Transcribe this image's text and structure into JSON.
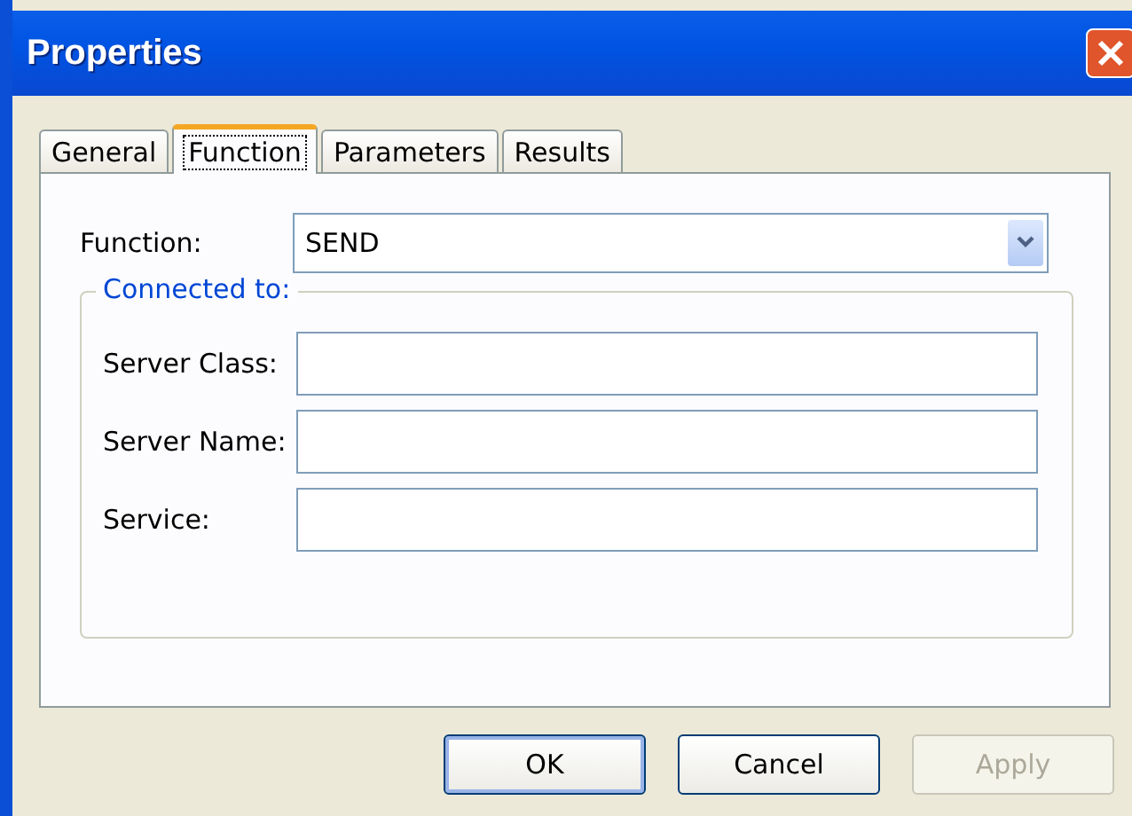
{
  "window": {
    "title": "Properties"
  },
  "tabs": [
    {
      "label": "General",
      "selected": false
    },
    {
      "label": "Function",
      "selected": true
    },
    {
      "label": "Parameters",
      "selected": false
    },
    {
      "label": "Results",
      "selected": false
    }
  ],
  "function_field": {
    "label": "Function:",
    "value": "SEND"
  },
  "group": {
    "title": "Connected to:",
    "fields": [
      {
        "label": "Server Class:"
      },
      {
        "label": "Server Name:"
      },
      {
        "label": "Service:"
      }
    ]
  },
  "buttons": [
    {
      "label": "OK",
      "default": true,
      "disabled": false
    },
    {
      "label": "Cancel",
      "default": false,
      "disabled": false
    },
    {
      "label": "Apply",
      "default": false,
      "disabled": true
    }
  ]
}
